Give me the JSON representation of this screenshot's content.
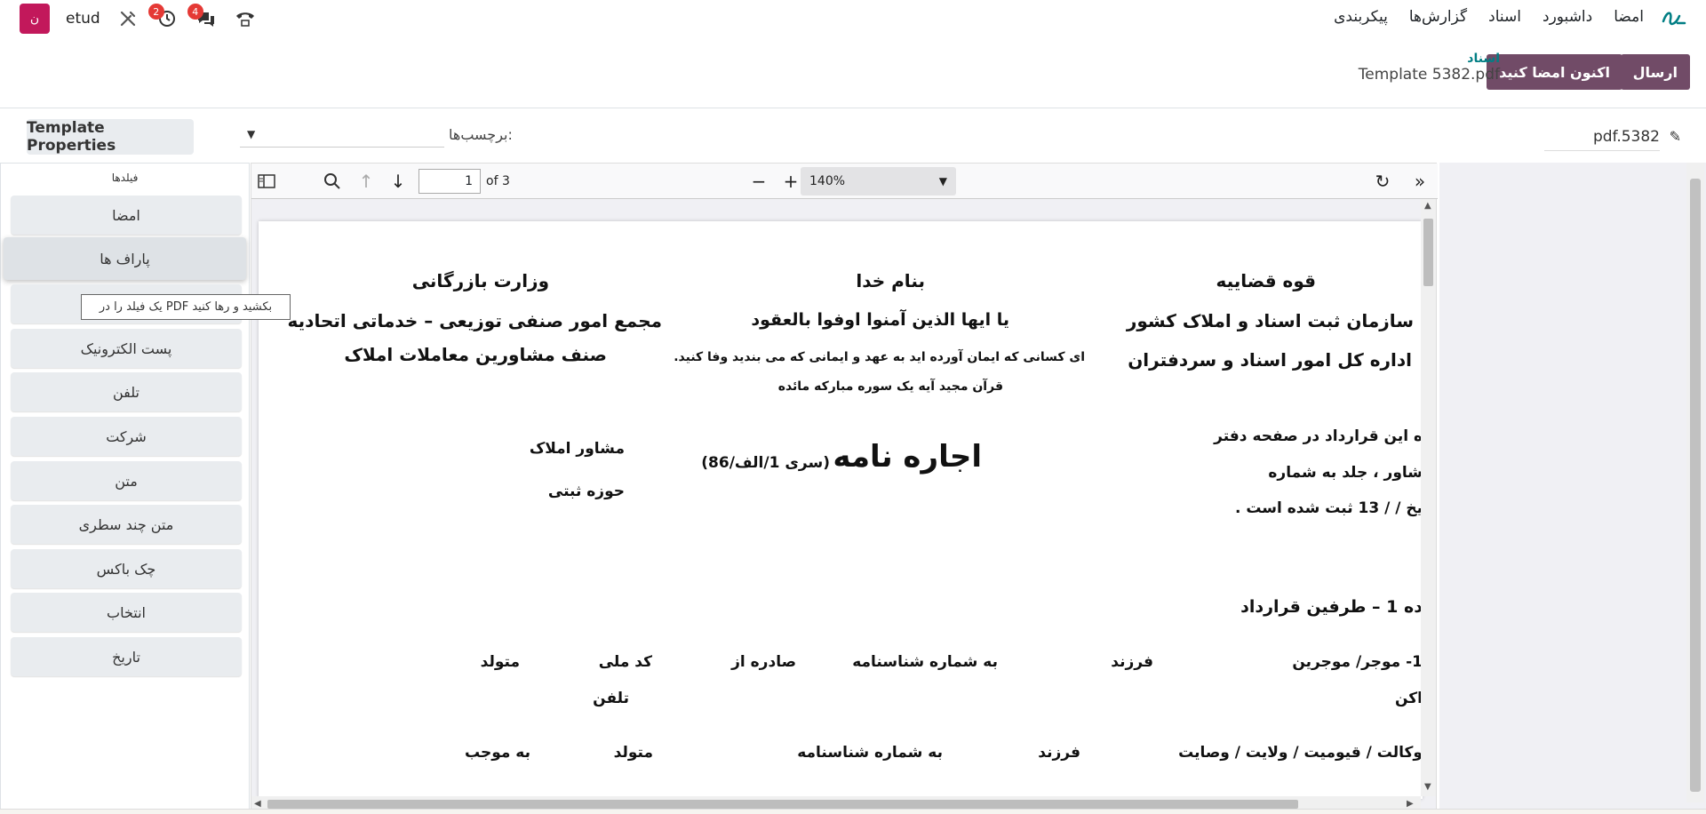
{
  "menu": {
    "brand": "sign-logo",
    "items": [
      "امضا",
      "داشبورد",
      "اسناد",
      "گزارش‌ها",
      "پیکربندی"
    ]
  },
  "systray": {
    "avatar_letter": "ن",
    "db_name": "etud",
    "activity_count": "2",
    "messages_count": "4"
  },
  "control": {
    "send_label": "ارسال",
    "sign_now_label": "اکنون امضا کنید",
    "breadcrumb_parent": "اسناد",
    "breadcrumb_current": "Template 5382.pdf"
  },
  "props": {
    "template_properties_label": "Template Properties",
    "tags_label": "برچسب‌ها:",
    "filename": "pdf.5382"
  },
  "sidebar": {
    "title": "فیلدها",
    "fields": [
      "امضا",
      "پاراف ها",
      "",
      "پست الکترونیک",
      "تلفن",
      "شرکت",
      "متن",
      "متن چند سطری",
      "چک باکس",
      "انتخاب",
      "تاریخ"
    ],
    "tooltip": "بکشید و رها کنید PDF یک فیلد را در"
  },
  "viewer": {
    "page_number": "1",
    "page_of": "of 3",
    "zoom": "140%"
  },
  "pdf": {
    "right_h1": "قوه قضاییه",
    "right_h2": "سازمان ثبت اسناد و املاک کشور",
    "right_h3": "اداره کل امور اسناد و سردفتران",
    "center_h1": "بنام خدا",
    "center_h2": "یا ایها الذین آمنوا اوفوا بالعقود",
    "center_h3": "ای کسانی که ایمان آورده اید به عهد و ایمانی که می بندید وفا کنید.",
    "center_h4": "قرآن مجید آیه یک سوره مبارکه مائده",
    "left_h1": "وزارت بازرگانی",
    "left_h2": "مجمع امور صنفی توزیعی – خدماتی اتحادیه",
    "left_h3": "صنف مشاورین معاملات املاک",
    "reg_1": "ه این قرارداد در صفحه      دفتر",
    "reg_2": "شاور ، جلد       به شماره",
    "reg_3": "یخ     /    /  13  ثبت شده است .",
    "title": "اجاره نامه",
    "series": "(سری 1/الف/86)",
    "advisor": "مشاور املاک",
    "registry": "حوزه ثبتی",
    "article": "ده 1 – طرفین قرارداد",
    "r1_c1": "1- موجر/ موجرین",
    "r1_c2": "فرزند",
    "r1_c3": "به شماره شناسنامه",
    "r1_c4": "صادره از",
    "r1_c5": "کد ملی",
    "r1_c6": "متولد",
    "r2_c1": "اکن",
    "r2_c2": "تلفن",
    "r3_c1": "وکالت / قیومیت / ولایت / وصایت",
    "r3_c2": "فرزند",
    "r3_c3": "به شماره شناسنامه",
    "r3_c4": "متولد",
    "r3_c5": "به موجب"
  },
  "colors": {
    "primary": "#714b67",
    "link": "#017e84",
    "avatar": "#c2185b",
    "badge": "#e53935"
  }
}
